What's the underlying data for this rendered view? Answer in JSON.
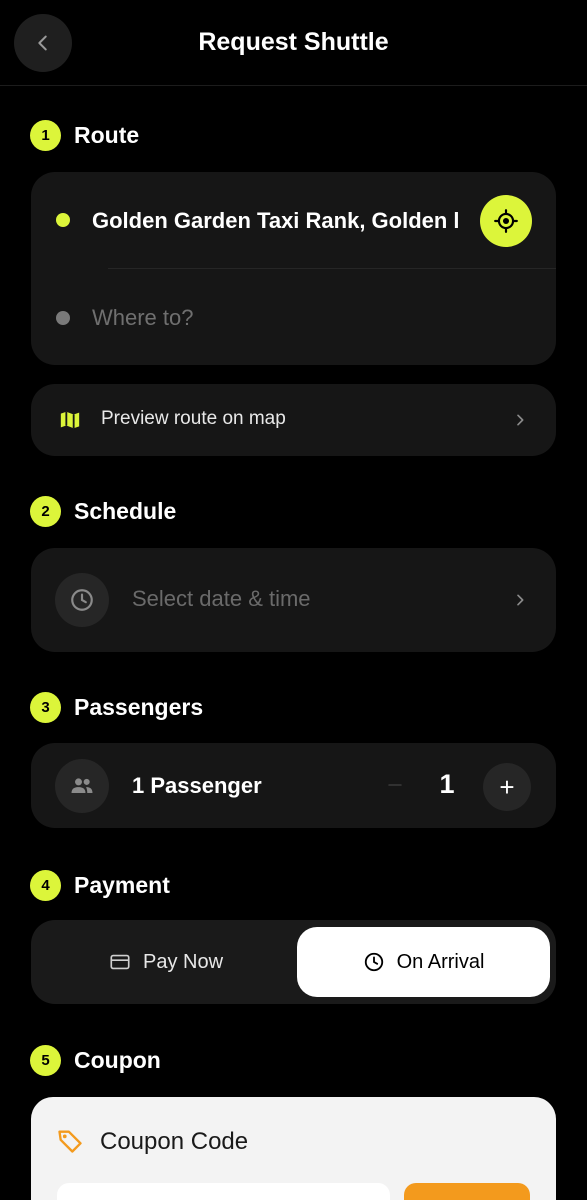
{
  "header": {
    "title": "Request Shuttle"
  },
  "route": {
    "step": "1",
    "title": "Route",
    "origin": "Golden Garden Taxi Rank, Golden l",
    "destination_placeholder": "Where to?",
    "preview_label": "Preview route on map"
  },
  "schedule": {
    "step": "2",
    "title": "Schedule",
    "placeholder": "Select date & time"
  },
  "passengers": {
    "step": "3",
    "title": "Passengers",
    "label": "1 Passenger",
    "count": "1",
    "minus": "−",
    "plus": "+"
  },
  "payment": {
    "step": "4",
    "title": "Payment",
    "options": [
      {
        "label": "Pay Now",
        "icon": "credit-card-icon",
        "selected": false
      },
      {
        "label": "On Arrival",
        "icon": "clock-icon",
        "selected": true
      }
    ]
  },
  "coupon": {
    "step": "5",
    "title": "Coupon",
    "card_title": "Coupon Code"
  },
  "colors": {
    "accent": "#dcf53a",
    "background": "#000000",
    "card": "#161616",
    "coupon_button": "#f39a1d"
  }
}
